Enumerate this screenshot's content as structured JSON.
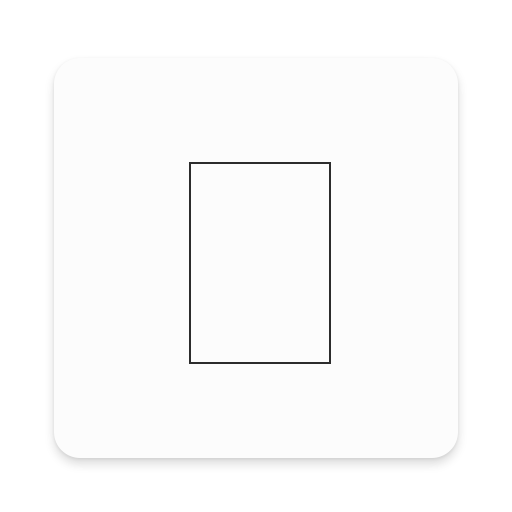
{
  "app_icon": {
    "icon_name": "rectangle-outline-icon",
    "card_color": "#fcfcfc",
    "glyph_stroke_color": "#2c2c2c",
    "background_color": "#ffffff"
  }
}
